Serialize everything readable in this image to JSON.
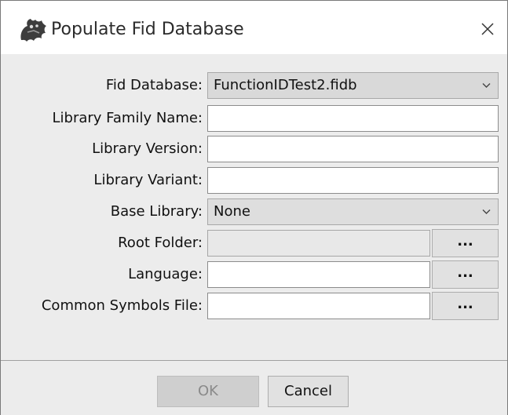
{
  "window": {
    "title": "Populate Fid Database",
    "icon": "dragon-logo-icon",
    "close_icon": "close-icon"
  },
  "form": {
    "fid_database": {
      "label": "Fid Database:",
      "value": "FunctionIDTest2.fidb"
    },
    "library_family_name": {
      "label": "Library Family Name:",
      "value": ""
    },
    "library_version": {
      "label": "Library Version:",
      "value": ""
    },
    "library_variant": {
      "label": "Library Variant:",
      "value": ""
    },
    "base_library": {
      "label": "Base Library:",
      "value": "None"
    },
    "root_folder": {
      "label": "Root Folder:",
      "value": "",
      "browse_label": "..."
    },
    "language": {
      "label": "Language:",
      "value": "",
      "browse_label": "..."
    },
    "common_symbols_file": {
      "label": "Common Symbols File:",
      "value": "",
      "browse_label": "..."
    }
  },
  "buttons": {
    "ok_label": "OK",
    "ok_enabled": false,
    "cancel_label": "Cancel"
  }
}
